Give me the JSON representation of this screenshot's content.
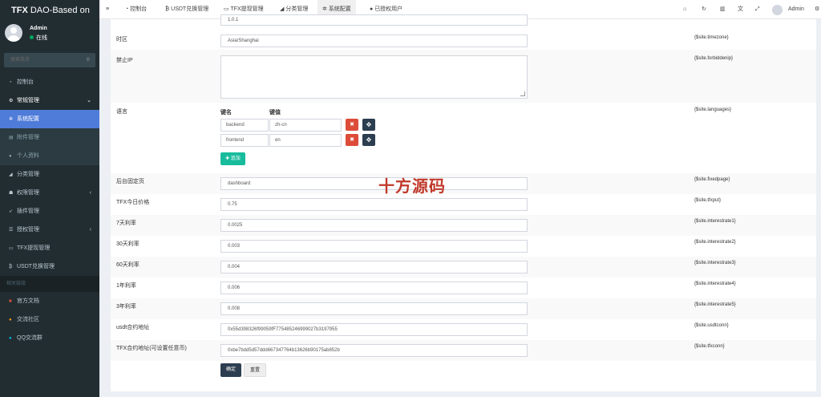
{
  "brand": {
    "bold": "TFX",
    "rest": " DAO-Based on"
  },
  "user": {
    "name": "Admin",
    "status": "在线"
  },
  "search": {
    "placeholder": "搜索菜单"
  },
  "sidebar": {
    "items": [
      {
        "label": "控制台",
        "icon": "dashboard-icon"
      },
      {
        "label": "常规管理",
        "icon": "cogs-icon"
      },
      {
        "label": "系统配置",
        "icon": "cog-icon"
      },
      {
        "label": "附件管理",
        "icon": "file-icon"
      },
      {
        "label": "个人资料",
        "icon": "user-icon"
      },
      {
        "label": "分类管理",
        "icon": "leaf-icon"
      },
      {
        "label": "权限管理",
        "icon": "group-icon"
      },
      {
        "label": "插件管理",
        "icon": "rocket-icon"
      },
      {
        "label": "授权管理",
        "icon": "list-icon"
      },
      {
        "label": "TFX提现管理",
        "icon": "card-icon"
      },
      {
        "label": "USDT兑换管理",
        "icon": "bitcoin-icon"
      }
    ],
    "section": "相关链接",
    "links": [
      {
        "label": "官方文档",
        "icon": "book-icon",
        "color": "#dd4b39"
      },
      {
        "label": "交流社区",
        "icon": "comment-icon",
        "color": "#f39c12"
      },
      {
        "label": "QQ交流群",
        "icon": "qq-icon",
        "color": "#00c0ef"
      }
    ]
  },
  "topnav": {
    "tabs": [
      "控制台",
      "USDT兑换管理",
      "TFX提现管理",
      "分类管理",
      "系统配置",
      "已授权用户"
    ],
    "admin": "Admin"
  },
  "form": {
    "top_partial": "1.0.1",
    "timezone": {
      "label": "时区",
      "value": "Asia/Shanghai",
      "var": "{$site.timezone}"
    },
    "forbiddenip": {
      "label": "禁止IP",
      "var": "{$site.forbiddenip}"
    },
    "languages": {
      "label": "语言",
      "var": "{$site.languages}",
      "key_header": "键名",
      "value_header": "键值",
      "rows": [
        {
          "key": "backend",
          "value": "zh-cn"
        },
        {
          "key": "frontend",
          "value": "en"
        }
      ],
      "add": "追加"
    },
    "fields": [
      {
        "label": "后台固定页",
        "value": "dashboard",
        "var": "{$site.fixedpage}"
      },
      {
        "label": "TFX今日价格",
        "value": "0.75",
        "var": "{$site.tfxput}"
      },
      {
        "label": "7天利率",
        "value": "0.0025",
        "var": "{$site.interestrate1}"
      },
      {
        "label": "30天利率",
        "value": "0.003",
        "var": "{$site.interestrate2}"
      },
      {
        "label": "60天利率",
        "value": "0.004",
        "var": "{$site.interestrate3}"
      },
      {
        "label": "1年利率",
        "value": "0.006",
        "var": "{$site.interestrate4}"
      },
      {
        "label": "3年利率",
        "value": "0.008",
        "var": "{$site.interestrate5}"
      },
      {
        "label": "usdt合约地址",
        "value": "0x55d398326f99059fF775485246999027b3197955",
        "var": "{$site.usdtconn}"
      },
      {
        "label": "TFX合约地址(可设置任意币)",
        "value": "0xbe7bdd5d57ddd667347764b13626b90175ab852b",
        "var": "{$site.tfxconn}"
      }
    ],
    "ok": "确定",
    "reset": "重置"
  },
  "watermark": "十方源码"
}
